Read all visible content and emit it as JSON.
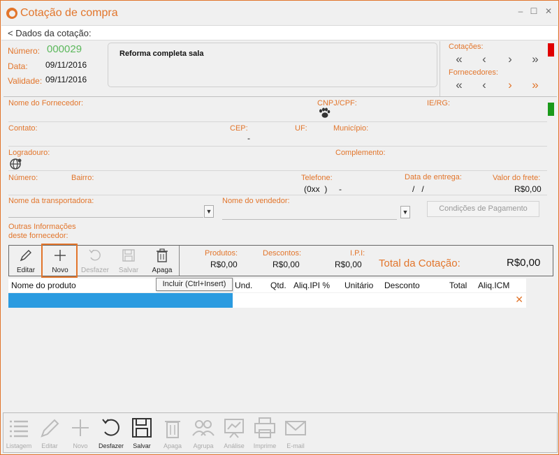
{
  "window": {
    "title": "Cotação de compra",
    "minimize": "–",
    "maximize": "☐",
    "close": "✕"
  },
  "section": {
    "label": "< Dados da cotação:"
  },
  "header": {
    "numero_label": "Número:",
    "numero_value": "000029",
    "data_label": "Data:",
    "data_value": "09/11/2016",
    "validade_label": "Validade:",
    "validade_value": "09/11/2016",
    "description": "Reforma completa sala"
  },
  "nav": {
    "cotacoes_label": "Cotações:",
    "fornecedores_label": "Fornecedores:",
    "first": "«",
    "prev": "‹",
    "next": "›",
    "last": "»"
  },
  "supplier": {
    "nome_label": "Nome do Fornecedor:",
    "cnpj_label": "CNPJ/CPF:",
    "ie_label": "IE/RG:",
    "contato_label": "Contato:",
    "cep_label": "CEP:",
    "cep_value": "-",
    "uf_label": "UF:",
    "municipio_label": "Município:",
    "logradouro_label": "Logradouro:",
    "complemento_label": "Complemento:",
    "numero_label": "Número:",
    "bairro_label": "Bairro:",
    "telefone_label": "Telefone:",
    "telefone_value": "(0xx  )     -",
    "entrega_label": "Data de entrega:",
    "entrega_value": "/   /",
    "frete_label": "Valor do frete:",
    "frete_value": "R$0,00",
    "transportadora_label": "Nome da transportadora:",
    "vendedor_label": "Nome do vendedor:",
    "condicoes_button": "Condições de Pagamento",
    "outras_label_1": "Outras Informações",
    "outras_label_2": "deste fornecedor:"
  },
  "toolbar": {
    "editar": "Editar",
    "novo": "Novo",
    "desfazer": "Desfazer",
    "salvar": "Salvar",
    "apaga": "Apaga"
  },
  "totals": {
    "produtos_label": "Produtos:",
    "produtos_value": "R$0,00",
    "descontos_label": "Descontos:",
    "descontos_value": "R$0,00",
    "ipi_label": "I.P.I:",
    "ipi_value": "R$0,00",
    "total_label": "Total da Cotação:",
    "total_value": "R$0,00"
  },
  "tooltip": "Incluir (Ctrl+Insert)",
  "grid": {
    "columns": [
      "Nome do produto",
      "Und.",
      "Qtd.",
      "Aliq.IPI %",
      "Unitário",
      "Desconto",
      "Total",
      "Aliq.ICM"
    ],
    "row_delete": "✕"
  },
  "bottom": {
    "listagem": "Listagem",
    "editar": "Editar",
    "novo": "Novo",
    "desfazer": "Desfazer",
    "salvar": "Salvar",
    "apaga": "Apaga",
    "agrupa": "Agrupa",
    "analise": "Análise",
    "imprime": "Imprime",
    "email": "E-mail"
  },
  "colors": {
    "accent": "#e2752b",
    "number_green": "#5cb85c",
    "status_red": "#e00000",
    "status_green": "#1a9a1a",
    "selection_blue": "#2b9be0"
  }
}
